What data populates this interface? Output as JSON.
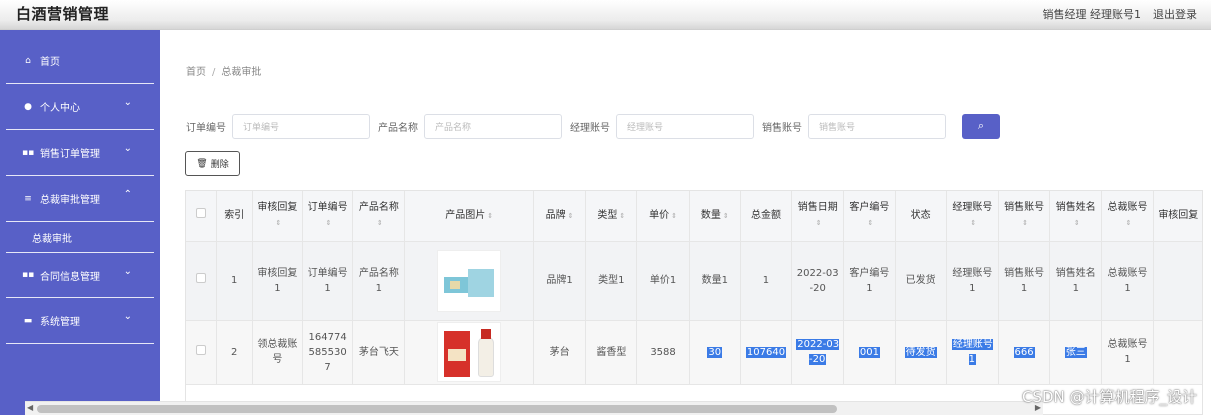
{
  "app_title": "白酒营销管理",
  "top_user": "销售经理 经理账号1",
  "logout": "退出登录",
  "sidebar": {
    "items": [
      {
        "label": "首页",
        "icon": "home-icon",
        "has_sub": false
      },
      {
        "label": "个人中心",
        "icon": "user-icon",
        "has_sub": true
      },
      {
        "label": "销售订单管理",
        "icon": "grid-icon",
        "has_sub": true
      },
      {
        "label": "总裁审批管理",
        "icon": "list-icon",
        "has_sub": true,
        "sub": [
          "总裁审批"
        ]
      },
      {
        "label": "合同信息管理",
        "icon": "grid-icon",
        "has_sub": true
      },
      {
        "label": "系统管理",
        "icon": "doc-icon",
        "has_sub": true
      }
    ]
  },
  "breadcrumb": {
    "home": "首页",
    "current": "总裁审批"
  },
  "search": {
    "fields": [
      {
        "label": "订单编号",
        "placeholder": "订单编号"
      },
      {
        "label": "产品名称",
        "placeholder": "产品名称"
      },
      {
        "label": "经理账号",
        "placeholder": "经理账号"
      },
      {
        "label": "销售账号",
        "placeholder": "销售账号"
      }
    ],
    "button_icon": "search-icon"
  },
  "delete_label": "删除",
  "table": {
    "headers": [
      "",
      "索引",
      "审核回复",
      "订单编号",
      "产品名称",
      "产品图片",
      "品牌",
      "类型",
      "单价",
      "数量",
      "总金额",
      "销售日期",
      "客户编号",
      "状态",
      "经理账号",
      "销售账号",
      "销售姓名",
      "总裁账号",
      "审核回复"
    ],
    "sortable": [
      false,
      false,
      true,
      true,
      true,
      true,
      true,
      true,
      true,
      true,
      false,
      true,
      true,
      false,
      true,
      true,
      true,
      true,
      false
    ],
    "rows": [
      {
        "index": "1",
        "reply": "审核回复1",
        "order_no": "订单编号1",
        "product": "产品名称1",
        "brand": "品牌1",
        "type": "类型1",
        "price": "单价1",
        "qty": "数量1",
        "total": "1",
        "date": "2022-03-20",
        "customer": "客户编号1",
        "status": "已发货",
        "manager": "经理账号1",
        "sales": "销售账号1",
        "sales_name": "销售姓名1",
        "ceo": "总裁账号1",
        "reply2": ""
      },
      {
        "index": "2",
        "reply": "领总裁账号",
        "order_no": "1647745855307",
        "product": "茅台飞天",
        "brand": "茅台",
        "type": "酱香型",
        "price": "3588",
        "qty": "30",
        "total": "107640",
        "date": "2022-03-20",
        "customer": "001",
        "status": "待发货",
        "manager": "经理账号1",
        "sales": "666",
        "sales_name": "张三",
        "ceo": "总裁账号1",
        "reply2": ""
      }
    ]
  },
  "watermark": "CSDN @计算机程序_设计"
}
